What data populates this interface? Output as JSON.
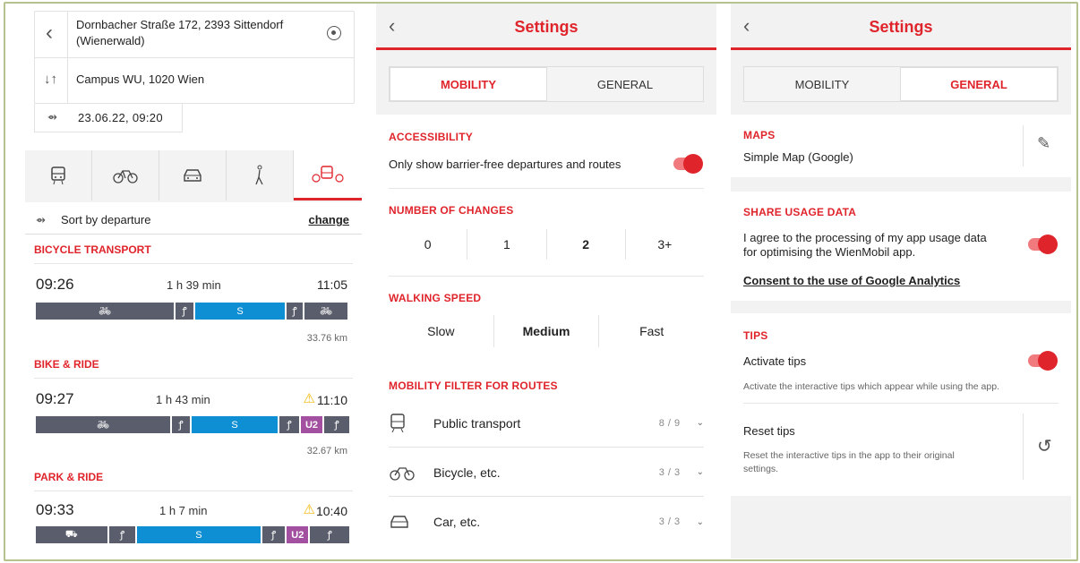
{
  "journey": {
    "from": "Dornbacher Straße 172, 2393 Sittendorf",
    "from_line2": "(Wienerwald)",
    "to": "Campus WU, 1020 Wien",
    "datetime": "23.06.22, 09:20",
    "sort_label": "Sort by departure",
    "change_label": "change",
    "categories": [
      {
        "name": "BICYCLE TRANSPORT",
        "dep": "09:26",
        "duration": "1 h 39 min",
        "arr": "11:05",
        "distance": "33.76 km",
        "warning": false
      },
      {
        "name": "BIKE & RIDE",
        "dep": "09:27",
        "duration": "1 h 43 min",
        "arr": "11:10",
        "distance": "32.67 km",
        "warning": true
      },
      {
        "name": "PARK & RIDE",
        "dep": "09:33",
        "duration": "1 h 7 min",
        "arr": "10:40",
        "distance": "",
        "warning": true
      }
    ],
    "line_u2": "U2",
    "mode_icons": [
      "bus-icon",
      "bicycle-icon",
      "car-icon",
      "walking-icon",
      "multimodal-icon"
    ]
  },
  "settings_mobility": {
    "title": "Settings",
    "tab_mobility": "MOBILITY",
    "tab_general": "GENERAL",
    "accessibility_title": "ACCESSIBILITY",
    "accessibility_text": "Only show barrier-free departures and routes",
    "changes_title": "NUMBER OF CHANGES",
    "changes": [
      "0",
      "1",
      "2",
      "3+"
    ],
    "changes_selected": "2",
    "walking_title": "WALKING SPEED",
    "walking": [
      "Slow",
      "Medium",
      "Fast"
    ],
    "walking_selected": "Medium",
    "filter_title": "MOBILITY FILTER FOR ROUTES",
    "filters": [
      {
        "label": "Public transport",
        "count": "8 / 9",
        "icon": "bus-icon"
      },
      {
        "label": "Bicycle, etc.",
        "count": "3 / 3",
        "icon": "bicycle-icon"
      },
      {
        "label": "Car, etc.",
        "count": "3 / 3",
        "icon": "car-icon"
      }
    ]
  },
  "settings_general": {
    "title": "Settings",
    "tab_mobility": "MOBILITY",
    "tab_general": "GENERAL",
    "maps_title": "MAPS",
    "maps_value": "Simple Map (Google)",
    "usage_title": "SHARE USAGE DATA",
    "usage_text1": "I agree to the processing of my app usage data",
    "usage_text2": "for optimising the WienMobil app.",
    "usage_link": "Consent to the use of Google Analytics",
    "tips_title": "TIPS",
    "tips_activate": "Activate tips",
    "tips_activate_desc": "Activate the interactive tips which appear while using the app.",
    "tips_reset": "Reset tips",
    "tips_reset_desc1": "Reset the interactive tips in the app to their original",
    "tips_reset_desc2": "settings."
  },
  "colors": {
    "accent": "#e0242b",
    "subway_blue": "#0f8fd3",
    "u2": "#a2509f",
    "segment_grey": "#5a5d6b"
  }
}
